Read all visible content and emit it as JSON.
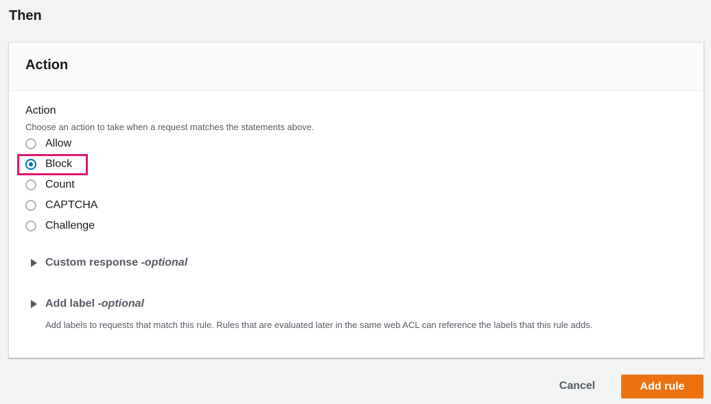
{
  "section_title": "Then",
  "panel": {
    "title": "Action",
    "field_label": "Action",
    "field_description": "Choose an action to take when a request matches the statements above.",
    "options": [
      {
        "label": "Allow",
        "checked": false
      },
      {
        "label": "Block",
        "checked": true
      },
      {
        "label": "Count",
        "checked": false
      },
      {
        "label": "CAPTCHA",
        "checked": false
      },
      {
        "label": "Challenge",
        "checked": false
      }
    ],
    "custom_response": {
      "title": "Custom response - ",
      "optional": "optional"
    },
    "add_label": {
      "title": "Add label - ",
      "optional": "optional",
      "description": "Add labels to requests that match this rule. Rules that are evaluated later in the same web ACL can reference the labels that this rule adds."
    }
  },
  "footer": {
    "cancel_label": "Cancel",
    "add_rule_label": "Add rule"
  },
  "colors": {
    "accent": "#0073bb",
    "primary_button": "#ec7211",
    "highlight_box": "#e0156f"
  }
}
